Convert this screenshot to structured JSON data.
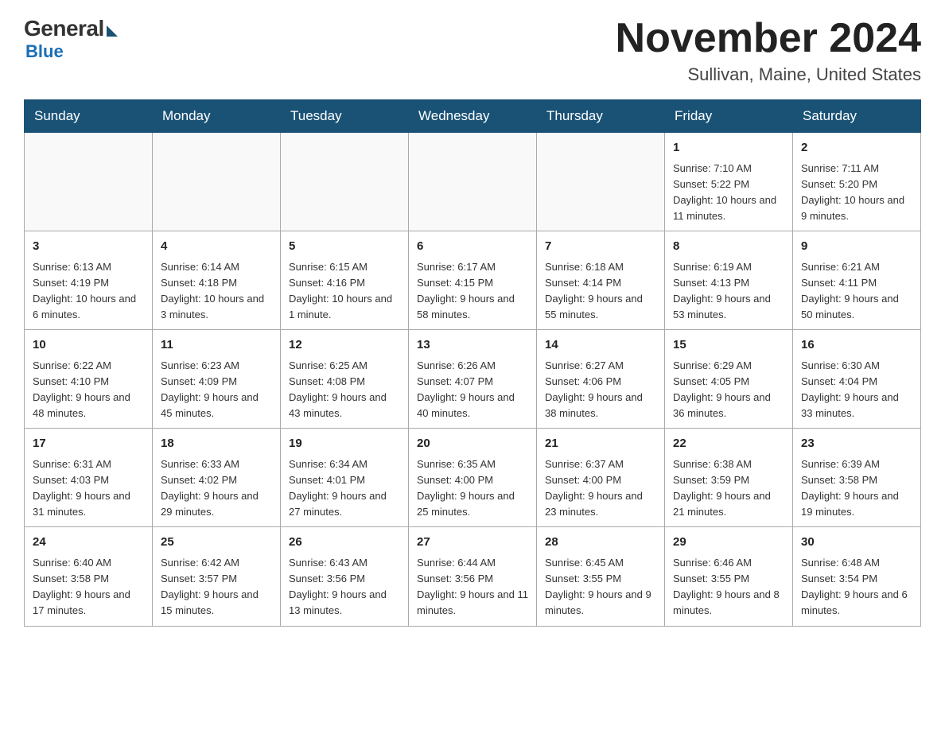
{
  "header": {
    "logo": {
      "general": "General",
      "blue": "Blue"
    },
    "month_year": "November 2024",
    "location": "Sullivan, Maine, United States"
  },
  "days_of_week": [
    "Sunday",
    "Monday",
    "Tuesday",
    "Wednesday",
    "Thursday",
    "Friday",
    "Saturday"
  ],
  "weeks": [
    [
      {
        "day": null
      },
      {
        "day": null
      },
      {
        "day": null
      },
      {
        "day": null
      },
      {
        "day": null
      },
      {
        "day": 1,
        "sunrise": "7:10 AM",
        "sunset": "5:22 PM",
        "daylight": "10 hours and 11 minutes."
      },
      {
        "day": 2,
        "sunrise": "7:11 AM",
        "sunset": "5:20 PM",
        "daylight": "10 hours and 9 minutes."
      }
    ],
    [
      {
        "day": 3,
        "sunrise": "6:13 AM",
        "sunset": "4:19 PM",
        "daylight": "10 hours and 6 minutes."
      },
      {
        "day": 4,
        "sunrise": "6:14 AM",
        "sunset": "4:18 PM",
        "daylight": "10 hours and 3 minutes."
      },
      {
        "day": 5,
        "sunrise": "6:15 AM",
        "sunset": "4:16 PM",
        "daylight": "10 hours and 1 minute."
      },
      {
        "day": 6,
        "sunrise": "6:17 AM",
        "sunset": "4:15 PM",
        "daylight": "9 hours and 58 minutes."
      },
      {
        "day": 7,
        "sunrise": "6:18 AM",
        "sunset": "4:14 PM",
        "daylight": "9 hours and 55 minutes."
      },
      {
        "day": 8,
        "sunrise": "6:19 AM",
        "sunset": "4:13 PM",
        "daylight": "9 hours and 53 minutes."
      },
      {
        "day": 9,
        "sunrise": "6:21 AM",
        "sunset": "4:11 PM",
        "daylight": "9 hours and 50 minutes."
      }
    ],
    [
      {
        "day": 10,
        "sunrise": "6:22 AM",
        "sunset": "4:10 PM",
        "daylight": "9 hours and 48 minutes."
      },
      {
        "day": 11,
        "sunrise": "6:23 AM",
        "sunset": "4:09 PM",
        "daylight": "9 hours and 45 minutes."
      },
      {
        "day": 12,
        "sunrise": "6:25 AM",
        "sunset": "4:08 PM",
        "daylight": "9 hours and 43 minutes."
      },
      {
        "day": 13,
        "sunrise": "6:26 AM",
        "sunset": "4:07 PM",
        "daylight": "9 hours and 40 minutes."
      },
      {
        "day": 14,
        "sunrise": "6:27 AM",
        "sunset": "4:06 PM",
        "daylight": "9 hours and 38 minutes."
      },
      {
        "day": 15,
        "sunrise": "6:29 AM",
        "sunset": "4:05 PM",
        "daylight": "9 hours and 36 minutes."
      },
      {
        "day": 16,
        "sunrise": "6:30 AM",
        "sunset": "4:04 PM",
        "daylight": "9 hours and 33 minutes."
      }
    ],
    [
      {
        "day": 17,
        "sunrise": "6:31 AM",
        "sunset": "4:03 PM",
        "daylight": "9 hours and 31 minutes."
      },
      {
        "day": 18,
        "sunrise": "6:33 AM",
        "sunset": "4:02 PM",
        "daylight": "9 hours and 29 minutes."
      },
      {
        "day": 19,
        "sunrise": "6:34 AM",
        "sunset": "4:01 PM",
        "daylight": "9 hours and 27 minutes."
      },
      {
        "day": 20,
        "sunrise": "6:35 AM",
        "sunset": "4:00 PM",
        "daylight": "9 hours and 25 minutes."
      },
      {
        "day": 21,
        "sunrise": "6:37 AM",
        "sunset": "4:00 PM",
        "daylight": "9 hours and 23 minutes."
      },
      {
        "day": 22,
        "sunrise": "6:38 AM",
        "sunset": "3:59 PM",
        "daylight": "9 hours and 21 minutes."
      },
      {
        "day": 23,
        "sunrise": "6:39 AM",
        "sunset": "3:58 PM",
        "daylight": "9 hours and 19 minutes."
      }
    ],
    [
      {
        "day": 24,
        "sunrise": "6:40 AM",
        "sunset": "3:58 PM",
        "daylight": "9 hours and 17 minutes."
      },
      {
        "day": 25,
        "sunrise": "6:42 AM",
        "sunset": "3:57 PM",
        "daylight": "9 hours and 15 minutes."
      },
      {
        "day": 26,
        "sunrise": "6:43 AM",
        "sunset": "3:56 PM",
        "daylight": "9 hours and 13 minutes."
      },
      {
        "day": 27,
        "sunrise": "6:44 AM",
        "sunset": "3:56 PM",
        "daylight": "9 hours and 11 minutes."
      },
      {
        "day": 28,
        "sunrise": "6:45 AM",
        "sunset": "3:55 PM",
        "daylight": "9 hours and 9 minutes."
      },
      {
        "day": 29,
        "sunrise": "6:46 AM",
        "sunset": "3:55 PM",
        "daylight": "9 hours and 8 minutes."
      },
      {
        "day": 30,
        "sunrise": "6:48 AM",
        "sunset": "3:54 PM",
        "daylight": "9 hours and 6 minutes."
      }
    ]
  ]
}
